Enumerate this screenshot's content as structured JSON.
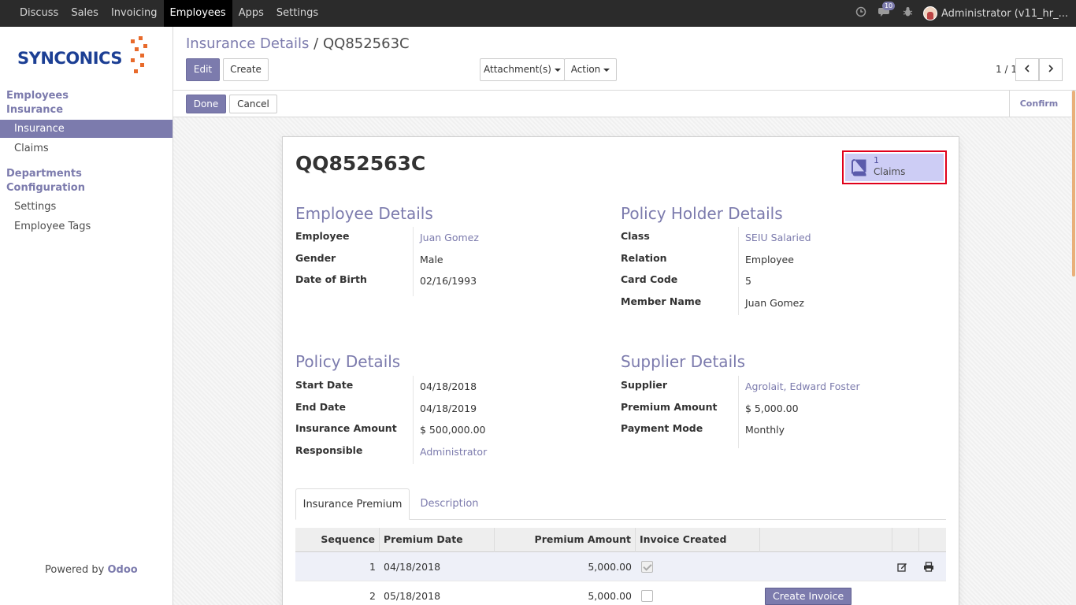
{
  "topbar": {
    "menu": [
      "Discuss",
      "Sales",
      "Invoicing",
      "Employees",
      "Apps",
      "Settings"
    ],
    "active": "Employees",
    "notification_count": "10",
    "user": "Administrator (v11_hr_..."
  },
  "sidebar": {
    "logo_text": "SYNCONICS",
    "sections": [
      {
        "label": "Employees",
        "items": []
      },
      {
        "label": "Insurance",
        "items": [
          "Insurance",
          "Claims"
        ]
      },
      {
        "label": "Departments",
        "items": []
      },
      {
        "label": "Configuration",
        "items": [
          "Settings",
          "Employee Tags"
        ]
      }
    ],
    "active_item": "Insurance",
    "powered_prefix": "Powered by",
    "powered_brand": "Odoo"
  },
  "control_panel": {
    "breadcrumb_parent": "Insurance Details",
    "breadcrumb_sep": "/",
    "breadcrumb_current": "QQ852563C",
    "edit_label": "Edit",
    "create_label": "Create",
    "attachments_label": "Attachment(s)",
    "action_label": "Action",
    "pager": "1 / 1"
  },
  "statusbar": {
    "done_label": "Done",
    "cancel_label": "Cancel",
    "confirm_label": "Confirm"
  },
  "record": {
    "title": "QQ852563C",
    "smart_button": {
      "count": "1",
      "label": "Claims"
    }
  },
  "employee_details": {
    "title": "Employee Details",
    "fields": [
      {
        "label": "Employee",
        "value": "Juan Gomez"
      },
      {
        "label": "Gender",
        "value": "Male"
      },
      {
        "label": "Date of Birth",
        "value": "02/16/1993"
      }
    ]
  },
  "policy_holder": {
    "title": "Policy Holder Details",
    "fields": [
      {
        "label": "Class",
        "value": "SEIU Salaried"
      },
      {
        "label": "Relation",
        "value": "Employee"
      },
      {
        "label": "Card Code",
        "value": "5"
      },
      {
        "label": "Member Name",
        "value": "Juan Gomez"
      }
    ]
  },
  "policy_details": {
    "title": "Policy Details",
    "fields": [
      {
        "label": "Start Date",
        "value": "04/18/2018"
      },
      {
        "label": "End Date",
        "value": "04/18/2019"
      },
      {
        "label": "Insurance Amount",
        "value": "$ 500,000.00"
      },
      {
        "label": "Responsible",
        "value": "Administrator"
      }
    ]
  },
  "supplier_details": {
    "title": "Supplier Details",
    "fields": [
      {
        "label": "Supplier",
        "value": "Agrolait, Edward Foster"
      },
      {
        "label": "Premium Amount",
        "value": "$ 5,000.00"
      },
      {
        "label": "Payment Mode",
        "value": "Monthly"
      }
    ]
  },
  "tabs": [
    "Insurance Premium",
    "Description"
  ],
  "premium_table": {
    "columns": [
      "Sequence",
      "Premium Date",
      "Premium Amount",
      "Invoice Created"
    ],
    "rows": [
      {
        "sequence": "1",
        "date": "04/18/2018",
        "amount": "5,000.00",
        "invoice_created": true
      },
      {
        "sequence": "2",
        "date": "05/18/2018",
        "amount": "5,000.00",
        "invoice_created": false,
        "action": "Create Invoice"
      }
    ]
  },
  "colors": {
    "accent": "#7c7bad",
    "topbar": "#2b2b2b",
    "highlight": "#e0001b"
  }
}
